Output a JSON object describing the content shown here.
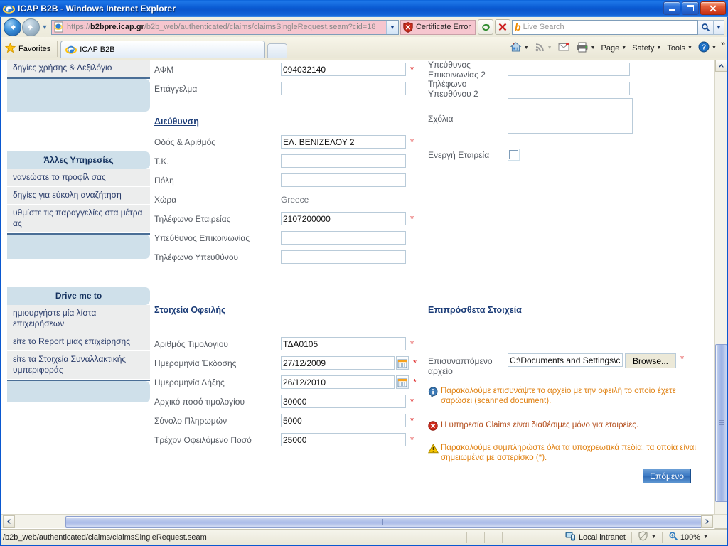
{
  "window": {
    "title": "ICAP B2B - Windows Internet Explorer",
    "minimize_label": "Minimize",
    "maximize_label": "Maximize",
    "close_label": "Close"
  },
  "navigation": {
    "back_label": "Back",
    "forward_label": "Forward",
    "recent_pages_label": "Recent Pages",
    "url_prefix": "https://",
    "url_domain": "b2bpre.icap.gr",
    "url_path": "/b2b_web/authenticated/claims/claimsSingleRequest.seam?cid=18",
    "cert_error_label": "Certificate Error",
    "refresh_label": "Refresh",
    "stop_label": "Stop",
    "search_placeholder": "Live Search",
    "search_value": "",
    "search_brand": "b"
  },
  "tabs": {
    "favorites_label": "Favorites",
    "items": [
      {
        "label": "ICAP B2B"
      }
    ],
    "new_tab_label": "New Tab"
  },
  "command_bar": {
    "home_label": "Home",
    "feeds_label": "Feeds",
    "mail_label": "Read Mail",
    "print_label": "Print",
    "page_label": "Page",
    "safety_label": "Safety",
    "tools_label": "Tools",
    "help_label": "Help",
    "overflow_label": "»"
  },
  "sidebar": {
    "top_item": "δηγίες χρήσης & Λεξιλόγιο",
    "sections": [
      {
        "heading": "Άλλες Υπηρεσίες",
        "items": [
          "νανεώστε το προφίλ σας",
          "δηγίες για εύκολη αναζήτηση",
          "υθμίστε τις παραγγελίες στα μέτρα ας"
        ]
      },
      {
        "heading": "Drive me to",
        "items": [
          "ημιουργήστε μία λίστα επιχειρήσεων",
          "είτε το Report μιας επιχείρησης",
          "είτε τα Στοιχεία Συναλλακτικής υμπεριφοράς"
        ]
      }
    ]
  },
  "form": {
    "company_fields": [
      {
        "label": "ΑΦΜ",
        "value": "094032140",
        "required": true,
        "type": "text"
      },
      {
        "label": "Επάγγελμα",
        "value": "",
        "required": false,
        "type": "text"
      }
    ],
    "address_heading": "Διεύθυνση",
    "address_fields": [
      {
        "label": "Οδός & Αριθμός",
        "value": "ΕΛ. ΒΕΝΙΖΕΛΟΥ 2",
        "required": true,
        "type": "text"
      },
      {
        "label": "Τ.Κ.",
        "value": "",
        "required": false,
        "type": "text"
      },
      {
        "label": "Πόλη",
        "value": "",
        "required": false,
        "type": "text"
      },
      {
        "label": "Χώρα",
        "value": "Greece",
        "required": false,
        "type": "static"
      },
      {
        "label": "Τηλέφωνο Εταιρείας",
        "value": "2107200000",
        "required": true,
        "type": "text"
      },
      {
        "label": "Υπεύθυνος Επικοινωνίας",
        "value": "",
        "required": false,
        "type": "text"
      },
      {
        "label": "Τηλέφωνο Υπευθύνου",
        "value": "",
        "required": false,
        "type": "text"
      }
    ],
    "contact2_fields": [
      {
        "label": "Υπεύθυνος Επικοινωνίας 2",
        "value": "",
        "required": false,
        "type": "text"
      },
      {
        "label": "Τηλέφωνο Υπευθύνου 2",
        "value": "",
        "required": false,
        "type": "text"
      }
    ],
    "comments_label": "Σχόλια",
    "comments_value": "",
    "active_company_label": "Ενεργή Εταιρεία",
    "active_company_checked": false,
    "debt_heading": "Στοιχεία Οφειλής",
    "debt_fields": [
      {
        "label": "Αριθμός Τιμολογίου",
        "value": "ΤΔΑ0105",
        "required": true,
        "type": "text"
      },
      {
        "label": "Ημερομηνία Έκδοσης",
        "value": "27/12/2009",
        "required": true,
        "type": "date"
      },
      {
        "label": "Ημερομηνία Λήξης",
        "value": "26/12/2010",
        "required": true,
        "type": "date"
      },
      {
        "label": "Αρχικό ποσό τιμολογίου",
        "value": "30000",
        "required": true,
        "type": "text"
      },
      {
        "label": "Σύνολο Πληρωμών",
        "value": "5000",
        "required": true,
        "type": "text"
      },
      {
        "label": "Τρέχον Οφειλόμενο Ποσό",
        "value": "25000",
        "required": true,
        "type": "text"
      }
    ],
    "extra_heading": "Επιπρόσθετα Στοιχεία",
    "attachment_label": "Επισυναπτόμενο αρχείο",
    "attachment_value": "C:\\Documents and Settings\\c",
    "attachment_required": true,
    "browse_label": "Browse...",
    "messages": [
      {
        "kind": "info",
        "text": "Παρακαλούμε επισυνάψτε το αρχείο με την οφειλή το οποίο έχετε σαρώσει (scanned document)."
      },
      {
        "kind": "error",
        "text": "Η υπηρεσία Claims είναι διαθέσιμες μόνο για εταιρείες."
      },
      {
        "kind": "warning",
        "text": "Παρακαλούμε συμπληρώστε όλα τα υποχρεωτικά πεδία, τα οποία είναι σημειωμένα με αστερίσκο (*)."
      }
    ],
    "next_button_label": "Επόμενο"
  },
  "status_bar": {
    "url": "/b2b_web/authenticated/claims/claimsSingleRequest.seam",
    "zone": "Local intranet",
    "zoom": "100%"
  },
  "colors": {
    "title_blue": "#0a58d0",
    "accent_link": "#1c3d78",
    "required_red": "#e03131",
    "warning_orange": "#e08214",
    "sidebar_header": "#cfe0ea",
    "sidebar_item": "#eceded",
    "button_blue": "#3b79c4"
  }
}
